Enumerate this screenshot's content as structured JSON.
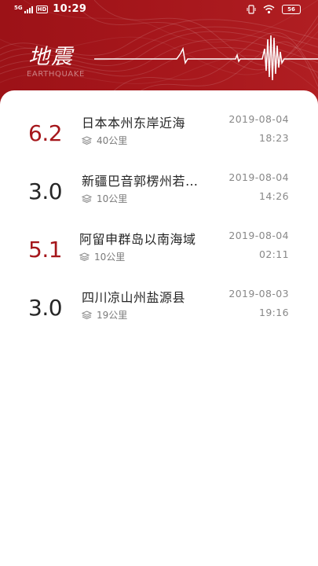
{
  "status_bar": {
    "network": "5G",
    "hd": "HD",
    "time": "10:29",
    "battery": "56"
  },
  "header": {
    "title": "地震",
    "subtitle": "EARTHQUAKE"
  },
  "colors": {
    "brand_red": "#a5161b",
    "strong_mag": "#a5161b",
    "normal_mag": "#262626"
  },
  "quakes": [
    {
      "magnitude": "6.2",
      "place": "日本本州东岸近海",
      "depth": "40公里",
      "date": "2019-08-04",
      "time": "18:23",
      "strong": true
    },
    {
      "magnitude": "3.0",
      "place": "新疆巴音郭楞州若…",
      "depth": "10公里",
      "date": "2019-08-04",
      "time": "14:26",
      "strong": false
    },
    {
      "magnitude": "5.1",
      "place": "阿留申群岛以南海域",
      "depth": "10公里",
      "date": "2019-08-04",
      "time": "02:11",
      "strong": true
    },
    {
      "magnitude": "3.0",
      "place": "四川凉山州盐源县",
      "depth": "19公里",
      "date": "2019-08-03",
      "time": "19:16",
      "strong": false
    }
  ],
  "icons": {
    "depth": "layers-icon",
    "wifi": "wifi-icon",
    "vibrate": "vibrate-icon",
    "signal": "signal-icon",
    "battery": "battery-icon"
  }
}
